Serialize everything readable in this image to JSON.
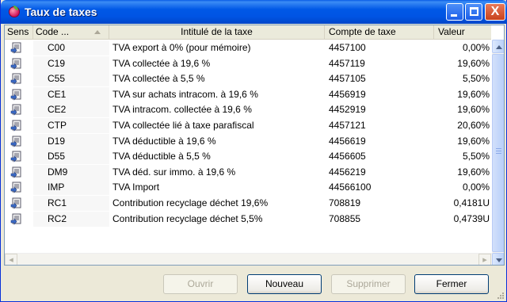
{
  "window": {
    "title": "Taux de taxes"
  },
  "columns": [
    "Sens",
    "Code ...",
    "Intitulé de la taxe",
    "Compte de taxe",
    "Valeur"
  ],
  "rows": [
    {
      "code": "C00",
      "label": "TVA export à 0% (pour mémoire)",
      "account": "4457100",
      "value": "0,00%"
    },
    {
      "code": "C19",
      "label": "TVA collectée à 19,6 %",
      "account": "4457119",
      "value": "19,60%"
    },
    {
      "code": "C55",
      "label": "TVA collectée à 5,5 %",
      "account": "4457105",
      "value": "5,50%"
    },
    {
      "code": "CE1",
      "label": "TVA sur achats intracom. à 19,6 %",
      "account": "4456919",
      "value": "19,60%"
    },
    {
      "code": "CE2",
      "label": "TVA intracom. collectée à 19,6 %",
      "account": "4452919",
      "value": "19,60%"
    },
    {
      "code": "CTP",
      "label": "TVA collectée lié à taxe parafiscal",
      "account": "4457121",
      "value": "20,60%"
    },
    {
      "code": "D19",
      "label": "TVA déductible à 19,6 %",
      "account": "4456619",
      "value": "19,60%"
    },
    {
      "code": "D55",
      "label": "TVA déductible à 5,5 %",
      "account": "4456605",
      "value": "5,50%"
    },
    {
      "code": "DM9",
      "label": "TVA déd. sur immo. à 19,6 %",
      "account": "4456219",
      "value": "19,60%"
    },
    {
      "code": "IMP",
      "label": "TVA Import",
      "account": "44566100",
      "value": "0,00%"
    },
    {
      "code": "RC1",
      "label": "Contribution recyclage déchet 19,6%",
      "account": "708819",
      "value": "0,4181U"
    },
    {
      "code": "RC2",
      "label": "Contribution recyclage déchet 5,5%",
      "account": "708855",
      "value": "0,4739U"
    }
  ],
  "buttons": {
    "open": "Ouvrir",
    "new": "Nouveau",
    "delete": "Supprimer",
    "close": "Fermer"
  },
  "window_controls": {
    "close_glyph": "X"
  }
}
